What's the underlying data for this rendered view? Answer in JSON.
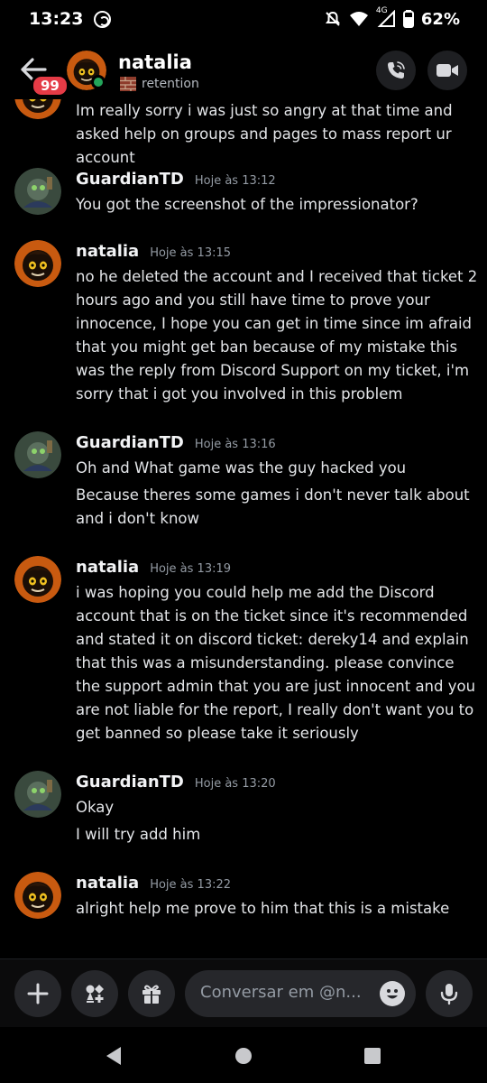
{
  "status_bar": {
    "time": "13:23",
    "battery": "62%",
    "network": "4G"
  },
  "header": {
    "badge_count": "99",
    "name": "natalia",
    "chevron": "›",
    "status": "retention"
  },
  "messages": [
    {
      "author": "",
      "time": "",
      "lines": [
        "Im really sorry i was just so angry at that time and asked help on groups and pages to mass report ur account"
      ]
    },
    {
      "author": "GuardianTD",
      "time": "Hoje às 13:12",
      "lines": [
        "You got the screenshot of the impressionator?"
      ]
    },
    {
      "author": "natalia",
      "time": "Hoje às 13:15",
      "lines": [
        "no he deleted the account and I received that ticket 2 hours ago and you still have time to prove your innocence, I hope you can get in time since im afraid that you might get ban because of my mistake this was the reply from Discord Support on my ticket, i'm sorry that i got you involved in this problem"
      ]
    },
    {
      "author": "GuardianTD",
      "time": "Hoje às 13:16",
      "lines": [
        "Oh and What game was the guy hacked you",
        "Because theres some games i don't never talk about and i don't know"
      ]
    },
    {
      "author": "natalia",
      "time": "Hoje às 13:19",
      "lines": [
        "i was hoping you could help me add the Discord account that is on the ticket since it's recommended and stated it on discord ticket: dereky14 and explain that this was a misunderstanding. please convince the support admin that you are just innocent and you are not liable for the report, I really don't want you to get banned so please take it seriously"
      ]
    },
    {
      "author": "GuardianTD",
      "time": "Hoje às 13:20",
      "lines": [
        "Okay",
        "I will try add him"
      ]
    },
    {
      "author": "natalia",
      "time": "Hoje às 13:22",
      "lines": [
        "alright help me prove to him that this is a mistake"
      ]
    }
  ],
  "composer": {
    "placeholder": "Conversar em @n...",
    "icons": [
      "plus-icon",
      "apps-icon",
      "gift-icon",
      "emoji-icon",
      "microphone-icon"
    ]
  },
  "colors": {
    "background": "#000000",
    "badge": "#e53b46",
    "online": "#23a55a",
    "pill": "#26272b"
  }
}
